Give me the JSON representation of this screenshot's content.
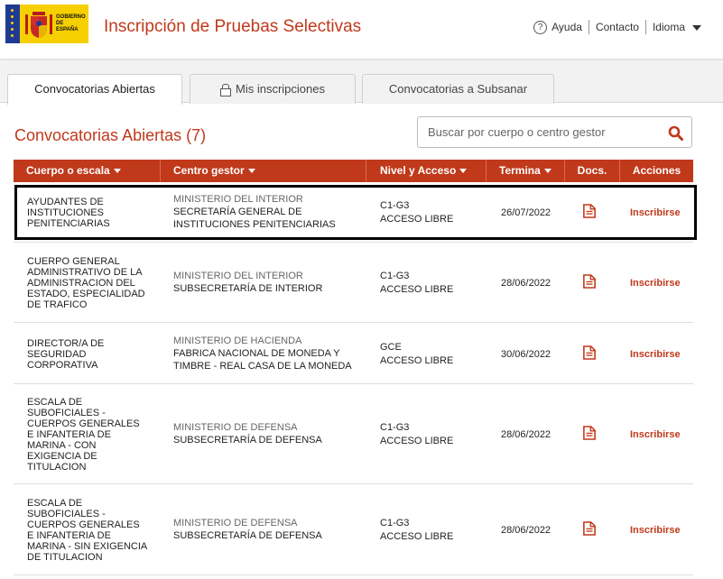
{
  "header": {
    "app_title": "Inscripción de Pruebas Selectivas",
    "logo_text": "GOBIERNO DE ESPAÑA",
    "help_label": "Ayuda",
    "contact_label": "Contacto",
    "language_label": "Idioma"
  },
  "tabs": [
    {
      "label": "Convocatorias Abiertas",
      "active": true
    },
    {
      "label": "Mis inscripciones",
      "active": false,
      "icon": "lock-icon"
    },
    {
      "label": "Convocatorias a Subsanar",
      "active": false
    }
  ],
  "section": {
    "title": "Convocatorias Abiertas (7)",
    "search_placeholder": "Buscar por cuerpo o centro gestor"
  },
  "table": {
    "columns": [
      "Cuerpo o escala",
      "Centro gestor",
      "Nivel y Acceso",
      "Terminа",
      "Docs.",
      "Acciones"
    ],
    "rows": [
      {
        "cuerpo": [
          "AYUDANTES DE",
          "INSTITUCIONES",
          "PENITENCIARIAS"
        ],
        "ministerio": "MINISTERIO DEL INTERIOR",
        "centro": [
          "SECRETARÍA GENERAL DE",
          "INSTITUCIONES PENITENCIARIAS"
        ],
        "nivel": "C1-G3",
        "acceso": "ACCESO LIBRE",
        "termina": "26/07/2022",
        "doc_icon": "document-icon",
        "action": "Inscribirse",
        "highlighted": true
      },
      {
        "cuerpo": [
          "CUERPO GENERAL",
          "ADMINISTRATIVO DE LA",
          "ADMINISTRACION DEL",
          "ESTADO, ESPECIALIDAD",
          "DE TRAFICO"
        ],
        "ministerio": "MINISTERIO DEL INTERIOR",
        "centro": [
          "SUBSECRETARÍA DE INTERIOR"
        ],
        "nivel": "C1-G3",
        "acceso": "ACCESO LIBRE",
        "termina": "28/06/2022",
        "doc_icon": "document-icon",
        "action": "Inscribirse"
      },
      {
        "cuerpo": [
          "DIRECTOR/A DE",
          "SEGURIDAD",
          "CORPORATIVA"
        ],
        "ministerio": "MINISTERIO DE HACIENDA",
        "centro": [
          "FABRICA NACIONAL DE MONEDA Y",
          "TIMBRE - REAL CASA DE LA MONEDA"
        ],
        "nivel": "GCE",
        "acceso": "ACCESO LIBRE",
        "termina": "30/06/2022",
        "doc_icon": "document-icon",
        "action": "Inscribirse"
      },
      {
        "cuerpo": [
          "ESCALA DE",
          "SUBOFICIALES -",
          "CUERPOS GENERALES",
          "E INFANTERIA DE",
          "MARINA - CON",
          "EXIGENCIA DE",
          "TITULACION"
        ],
        "ministerio": "MINISTERIO DE DEFENSA",
        "centro": [
          "SUBSECRETARÍA DE DEFENSA"
        ],
        "nivel": "C1-G3",
        "acceso": "ACCESO LIBRE",
        "termina": "28/06/2022",
        "doc_icon": "document-icon",
        "action": "Inscribirse"
      },
      {
        "cuerpo": [
          "ESCALA DE",
          "SUBOFICIALES -",
          "CUERPOS GENERALES",
          "E INFANTERIA DE",
          "MARINA - SIN EXIGENCIA",
          "DE TITULACION"
        ],
        "ministerio": "MINISTERIO DE DEFENSA",
        "centro": [
          "SUBSECRETARÍA DE DEFENSA"
        ],
        "nivel": "C1-G3",
        "acceso": "ACCESO LIBRE",
        "termina": "28/06/2022",
        "doc_icon": "document-icon",
        "action": "Inscribirse"
      }
    ]
  },
  "colors": {
    "accent": "#c0391b",
    "header_bg": "#c0391b",
    "logo_yellow": "#f6d000",
    "eu_blue": "#1f3a93"
  }
}
